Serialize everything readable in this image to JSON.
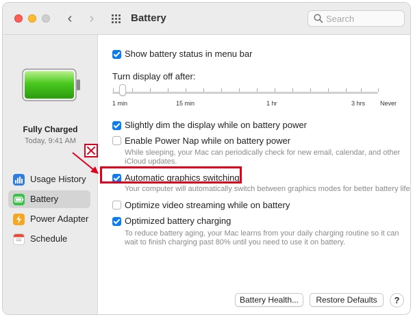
{
  "window": {
    "title": "Battery",
    "search_placeholder": "Search",
    "nav": {
      "back": "‹",
      "forward": "›"
    }
  },
  "sidebar": {
    "charge_status": "Fully Charged",
    "charge_time": "Today, 9:41 AM",
    "items": [
      {
        "label": "Usage History",
        "icon": "usage-history-icon",
        "color": "#2f7de1",
        "selected": false
      },
      {
        "label": "Battery",
        "icon": "battery-icon",
        "color": "#3cc24a",
        "selected": true
      },
      {
        "label": "Power Adapter",
        "icon": "power-adapter-icon",
        "color": "#f5a623",
        "selected": false
      },
      {
        "label": "Schedule",
        "icon": "schedule-icon",
        "color": "#e84b3c",
        "selected": false
      }
    ]
  },
  "main": {
    "show_status": {
      "label": "Show battery status in menu bar",
      "checked": true
    },
    "display_off": {
      "label": "Turn display off after:",
      "ticks": [
        "1 min",
        "15 min",
        "1 hr",
        "3 hrs",
        "Never"
      ]
    },
    "options": [
      {
        "label": "Slightly dim the display while on battery power",
        "checked": true,
        "description": ""
      },
      {
        "label": "Enable Power Nap while on battery power",
        "checked": false,
        "description": "While sleeping, your Mac can periodically check for new email, calendar, and other iCloud updates."
      },
      {
        "label": "Automatic graphics switching",
        "checked": true,
        "description": "Your computer will automatically switch between graphics modes for better battery life."
      },
      {
        "label": "Optimize video streaming while on battery",
        "checked": false,
        "description": ""
      },
      {
        "label": "Optimized battery charging",
        "checked": true,
        "description": "To reduce battery aging, your Mac learns from your daily charging routine so it can wait to finish charging past 80% until you need to use it on battery."
      }
    ],
    "buttons": {
      "battery_health": "Battery Health...",
      "restore_defaults": "Restore Defaults",
      "help": "?"
    }
  },
  "annotation": {
    "color": "#e0001b"
  }
}
